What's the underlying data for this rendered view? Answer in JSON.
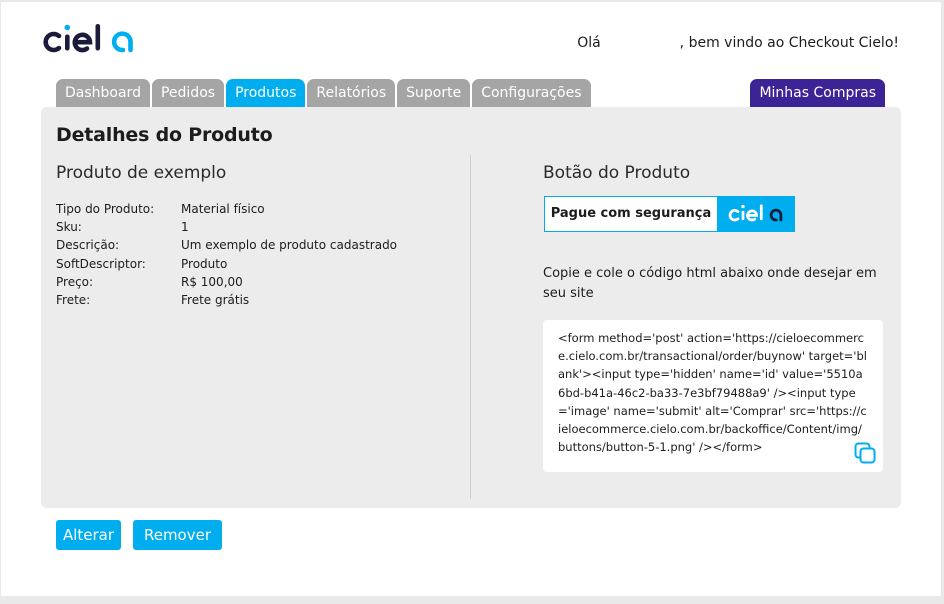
{
  "header": {
    "logo_text": "cielo",
    "greeting_prefix": "Olá",
    "greeting_suffix": ", bem vindo ao Checkout Cielo!"
  },
  "tabs": [
    {
      "label": "Dashboard",
      "active": false
    },
    {
      "label": "Pedidos",
      "active": false
    },
    {
      "label": "Produtos",
      "active": true
    },
    {
      "label": "Relatórios",
      "active": false
    },
    {
      "label": "Suporte",
      "active": false
    },
    {
      "label": "Configurações",
      "active": false
    }
  ],
  "tab_right": {
    "label": "Minhas Compras"
  },
  "panel": {
    "title": "Detalhes do Produto",
    "left_title": "Produto de exemplo",
    "details": [
      {
        "label": "Tipo do Produto:",
        "value": "Material físico"
      },
      {
        "label": "Sku:",
        "value": "1"
      },
      {
        "label": "Descrição:",
        "value": "Um exemplo de produto cadastrado"
      },
      {
        "label": "SoftDescriptor:",
        "value": "Produto"
      },
      {
        "label": "Preço:",
        "value": "R$ 100,00"
      },
      {
        "label": "Frete:",
        "value": "Frete grátis"
      }
    ],
    "right_title": "Botão do Produto",
    "buy_button_label": "Pague com segurança",
    "copy_instructions": "Copie e cole o código html abaixo onde desejar em seu site",
    "html_code": "<form method='post' action='https://cieloecommerce.cielo.com.br/transactional/order/buynow' target='blank'><input type='hidden' name='id' value='5510a6bd-b41a-46c2-ba33-7e3bf79488a9' /><input type='image' name='submit' alt='Comprar' src='https://cieloecommerce.cielo.com.br/backoffice/Content/img/buttons/button-5-1.png' /></form>"
  },
  "actions": {
    "alterar_label": "Alterar",
    "remover_label": "Remover"
  },
  "colors": {
    "accent": "#00aeef",
    "tab_inactive": "#a5a5a5",
    "tab_purple": "#3d2496",
    "logo": "#1b1b3a"
  },
  "icons": {
    "copy": "copy-icon"
  }
}
